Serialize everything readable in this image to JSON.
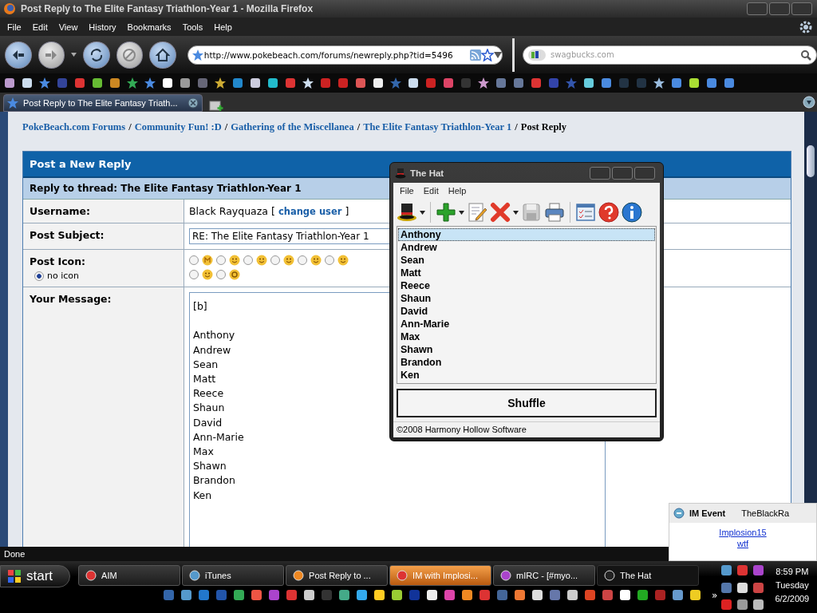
{
  "window": {
    "title": "Post Reply to The Elite Fantasy Triathlon-Year 1 - Mozilla Firefox"
  },
  "menu": [
    "File",
    "Edit",
    "View",
    "History",
    "Bookmarks",
    "Tools",
    "Help"
  ],
  "address_bar": {
    "value": "http://www.pokebeach.com/forums/newreply.php?tid=5496"
  },
  "search_field": {
    "placeholder": "swagbucks.com"
  },
  "tabs": [
    {
      "label": "Post Reply to The Elite Fantasy Triath...",
      "selected": true
    }
  ],
  "breadcrumb": [
    {
      "label": "PokeBeach.com Forums",
      "kind": "link"
    },
    {
      "label": "/",
      "kind": "separator"
    },
    {
      "label": "Community Fun! :D",
      "kind": "link"
    },
    {
      "label": "/",
      "kind": "separator"
    },
    {
      "label": "Gathering of the Miscellanea",
      "kind": "link"
    },
    {
      "label": "/",
      "kind": "separator"
    },
    {
      "label": "The Elite Fantasy Triathlon-Year 1",
      "kind": "link"
    },
    {
      "label": "/",
      "kind": "separator"
    },
    {
      "label": "Post Reply",
      "kind": "current"
    }
  ],
  "form": {
    "title": "Post a New Reply",
    "subtitle": "Reply to thread: The Elite Fantasy Triathlon-Year 1",
    "username_label": "Username:",
    "username": "Black Rayquaza",
    "bracket_open": "[",
    "change_user": "change user",
    "bracket_close": "]",
    "subject_label": "Post Subject:",
    "subject": "RE: The Elite Fantasy Triathlon-Year 1",
    "icon_label": "Post Icon:",
    "no_icon": {
      "label": "no icon",
      "selected": true
    },
    "post_icons": [
      [
        {
          "selected": false
        },
        {
          "selected": false
        },
        {
          "selected": false
        },
        {
          "selected": false
        },
        {
          "selected": false
        },
        {
          "selected": false
        }
      ],
      [
        {
          "selected": false
        },
        {
          "selected": false
        }
      ]
    ],
    "message_label": "Your Message:",
    "message": "[b]\n\nAnthony\nAndrew\nSean\nMatt\nReece\nShaun\nDavid\nAnn-Marie\nMax\nShawn\nBrandon\nKen"
  },
  "status_bar": "Done",
  "hat_window": {
    "title": "The Hat",
    "menu": [
      "File",
      "Edit",
      "Help"
    ],
    "names": [
      {
        "label": "Anthony",
        "selected": true
      },
      {
        "label": "Andrew",
        "selected": false
      },
      {
        "label": "Sean",
        "selected": false
      },
      {
        "label": "Matt",
        "selected": false
      },
      {
        "label": "Reece",
        "selected": false
      },
      {
        "label": "Shaun",
        "selected": false
      },
      {
        "label": "David",
        "selected": false
      },
      {
        "label": "Ann-Marie",
        "selected": false
      },
      {
        "label": "Max",
        "selected": false
      },
      {
        "label": "Shawn",
        "selected": false
      },
      {
        "label": "Brandon",
        "selected": false
      },
      {
        "label": "Ken",
        "selected": false
      }
    ],
    "button": "Shuffle",
    "status": "©2008 Harmony Hollow Software"
  },
  "im_popup": {
    "title": "IM Event",
    "sender": "TheBlackRa",
    "link": "Implosion15",
    "message": "wtf"
  },
  "taskbar": {
    "start": "start",
    "tasks": [
      {
        "label": "AIM",
        "selected": false,
        "flashing": false
      },
      {
        "label": "iTunes",
        "selected": false,
        "flashing": false
      },
      {
        "label": "Post Reply to ...",
        "selected": false,
        "flashing": false
      },
      {
        "label": "IM with Implosi...",
        "selected": false,
        "flashing": true
      },
      {
        "label": "mIRC - [#myo...",
        "selected": false,
        "flashing": false
      },
      {
        "label": "The Hat",
        "selected": true,
        "flashing": false
      }
    ],
    "more": "»",
    "clock": {
      "time": "8:59 PM",
      "day": "Tuesday",
      "date": "6/2/2009"
    }
  }
}
